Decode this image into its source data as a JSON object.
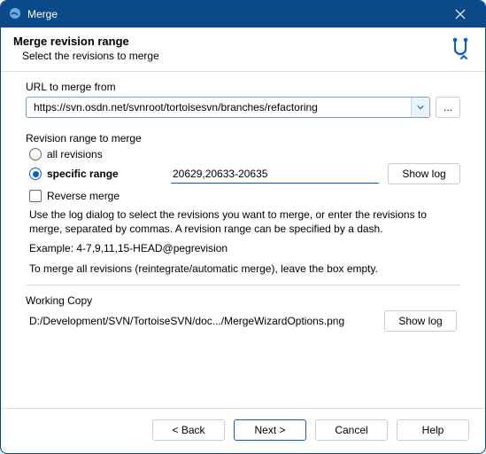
{
  "titlebar": {
    "title": "Merge"
  },
  "header": {
    "title": "Merge revision range",
    "subtitle": "Select the revisions to merge"
  },
  "url_section": {
    "label": "URL to merge from",
    "value": "https://svn.osdn.net/svnroot/tortoisesvn/branches/refactoring",
    "browse_label": "..."
  },
  "revision_section": {
    "label": "Revision range to merge",
    "all_label": "all revisions",
    "specific_label": "specific range",
    "range_value": "20629,20633-20635",
    "show_log_label": "Show log",
    "reverse_label": "Reverse merge",
    "help1": "Use the log dialog to select the revisions you want to merge, or enter the revisions to merge, separated by commas. A revision range can be specified by a dash.",
    "help2": "Example: 4-7,9,11,15-HEAD@pegrevision",
    "help3": "To merge all revisions (reintegrate/automatic merge), leave the box empty."
  },
  "wc_section": {
    "label": "Working Copy",
    "path": "D:/Development/SVN/TortoiseSVN/doc.../MergeWizardOptions.png",
    "show_log_label": "Show log"
  },
  "footer": {
    "back": "< Back",
    "next": "Next >",
    "cancel": "Cancel",
    "help": "Help"
  }
}
